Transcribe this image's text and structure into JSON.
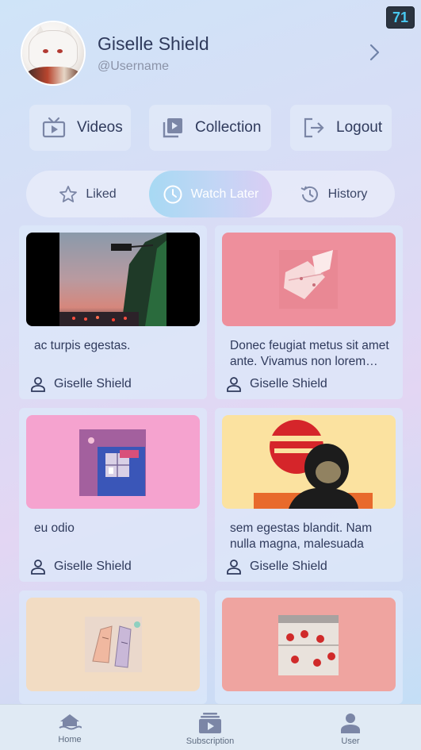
{
  "status": {
    "fps": "71"
  },
  "profile": {
    "name": "Giselle Shield",
    "username": "@Username"
  },
  "actions": [
    {
      "label": "Videos",
      "icon": "tv-icon"
    },
    {
      "label": "Collection",
      "icon": "collection-icon"
    },
    {
      "label": "Logout",
      "icon": "logout-icon"
    }
  ],
  "tabs": [
    {
      "label": "Liked",
      "icon": "star-icon",
      "active": false
    },
    {
      "label": "Watch Later",
      "icon": "clock-icon",
      "active": true
    },
    {
      "label": "History",
      "icon": "history-icon",
      "active": false
    }
  ],
  "videos": [
    {
      "title": "ac turpis egestas.",
      "author": "Giselle Shield",
      "thumb": "dusk-road"
    },
    {
      "title": "Donec feugiat metus sit amet ante. Vivamus non lorem vitae odio",
      "author": "Giselle Shield",
      "thumb": "pink-envelope"
    },
    {
      "title": "eu odio",
      "author": "Giselle Shield",
      "thumb": "pink-room"
    },
    {
      "title": "sem egestas blandit. Nam nulla magna, malesuada",
      "author": "Giselle Shield",
      "thumb": "red-sun-portrait"
    },
    {
      "title": "",
      "author": "",
      "thumb": "hands-sketch"
    },
    {
      "title": "",
      "author": "",
      "thumb": "strawberry-train"
    }
  ],
  "nav": [
    {
      "label": "Home",
      "icon": "home-icon"
    },
    {
      "label": "Subscription",
      "icon": "subscription-icon"
    },
    {
      "label": "User",
      "icon": "user-icon"
    }
  ],
  "colors": {
    "accent": "#a7d9f3",
    "text": "#2f3a5c",
    "muted": "#8b93a8"
  }
}
